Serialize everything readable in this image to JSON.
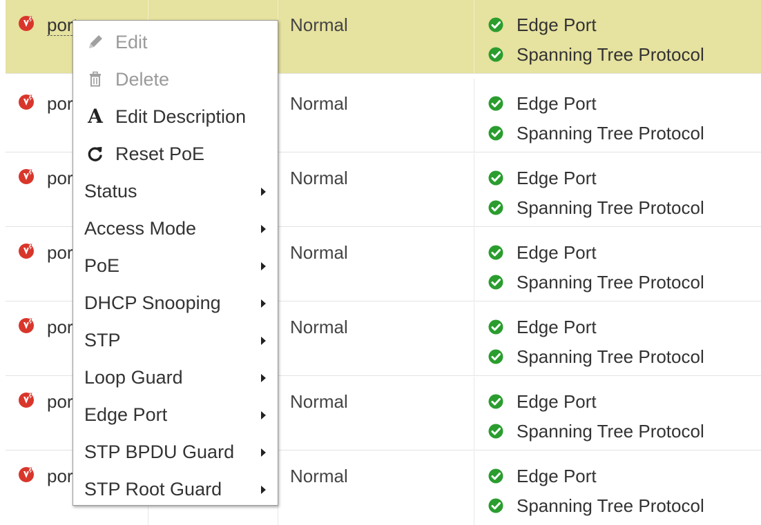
{
  "colors": {
    "selected_row_bg": "#e6e29f",
    "port_icon_red": "#d9362b",
    "check_green": "#2a9d2e",
    "disabled_text": "#9a9a9a"
  },
  "rows": [
    {
      "port_name": "port",
      "mode": "Normal",
      "features": [
        "Edge Port",
        "Spanning Tree Protocol"
      ],
      "selected": true
    },
    {
      "port_name": "port",
      "mode": "Normal",
      "features": [
        "Edge Port",
        "Spanning Tree Protocol"
      ],
      "selected": false
    },
    {
      "port_name": "port",
      "mode": "Normal",
      "features": [
        "Edge Port",
        "Spanning Tree Protocol"
      ],
      "selected": false
    },
    {
      "port_name": "port",
      "mode": "Normal",
      "features": [
        "Edge Port",
        "Spanning Tree Protocol"
      ],
      "selected": false
    },
    {
      "port_name": "port",
      "mode": "Normal",
      "features": [
        "Edge Port",
        "Spanning Tree Protocol"
      ],
      "selected": false
    },
    {
      "port_name": "port",
      "mode": "Normal",
      "features": [
        "Edge Port",
        "Spanning Tree Protocol"
      ],
      "selected": false
    },
    {
      "port_name": "port",
      "mode": "Normal",
      "features": [
        "Edge Port",
        "Spanning Tree Protocol"
      ],
      "selected": false
    }
  ],
  "context_menu": {
    "items": [
      {
        "label": "Edit",
        "icon": "pencil-icon",
        "disabled": true,
        "submenu": false
      },
      {
        "label": "Delete",
        "icon": "trash-icon",
        "disabled": true,
        "submenu": false
      },
      {
        "label": "Edit Description",
        "icon": "text-a-icon",
        "disabled": false,
        "submenu": false
      },
      {
        "label": "Reset PoE",
        "icon": "refresh-icon",
        "disabled": false,
        "submenu": false
      },
      {
        "label": "Status",
        "icon": null,
        "disabled": false,
        "submenu": true
      },
      {
        "label": "Access Mode",
        "icon": null,
        "disabled": false,
        "submenu": true
      },
      {
        "label": "PoE",
        "icon": null,
        "disabled": false,
        "submenu": true
      },
      {
        "label": "DHCP Snooping",
        "icon": null,
        "disabled": false,
        "submenu": true
      },
      {
        "label": "STP",
        "icon": null,
        "disabled": false,
        "submenu": true
      },
      {
        "label": "Loop Guard",
        "icon": null,
        "disabled": false,
        "submenu": true
      },
      {
        "label": "Edge Port",
        "icon": null,
        "disabled": false,
        "submenu": true
      },
      {
        "label": "STP BPDU Guard",
        "icon": null,
        "disabled": false,
        "submenu": true
      },
      {
        "label": "STP Root Guard",
        "icon": null,
        "disabled": false,
        "submenu": true
      }
    ]
  }
}
